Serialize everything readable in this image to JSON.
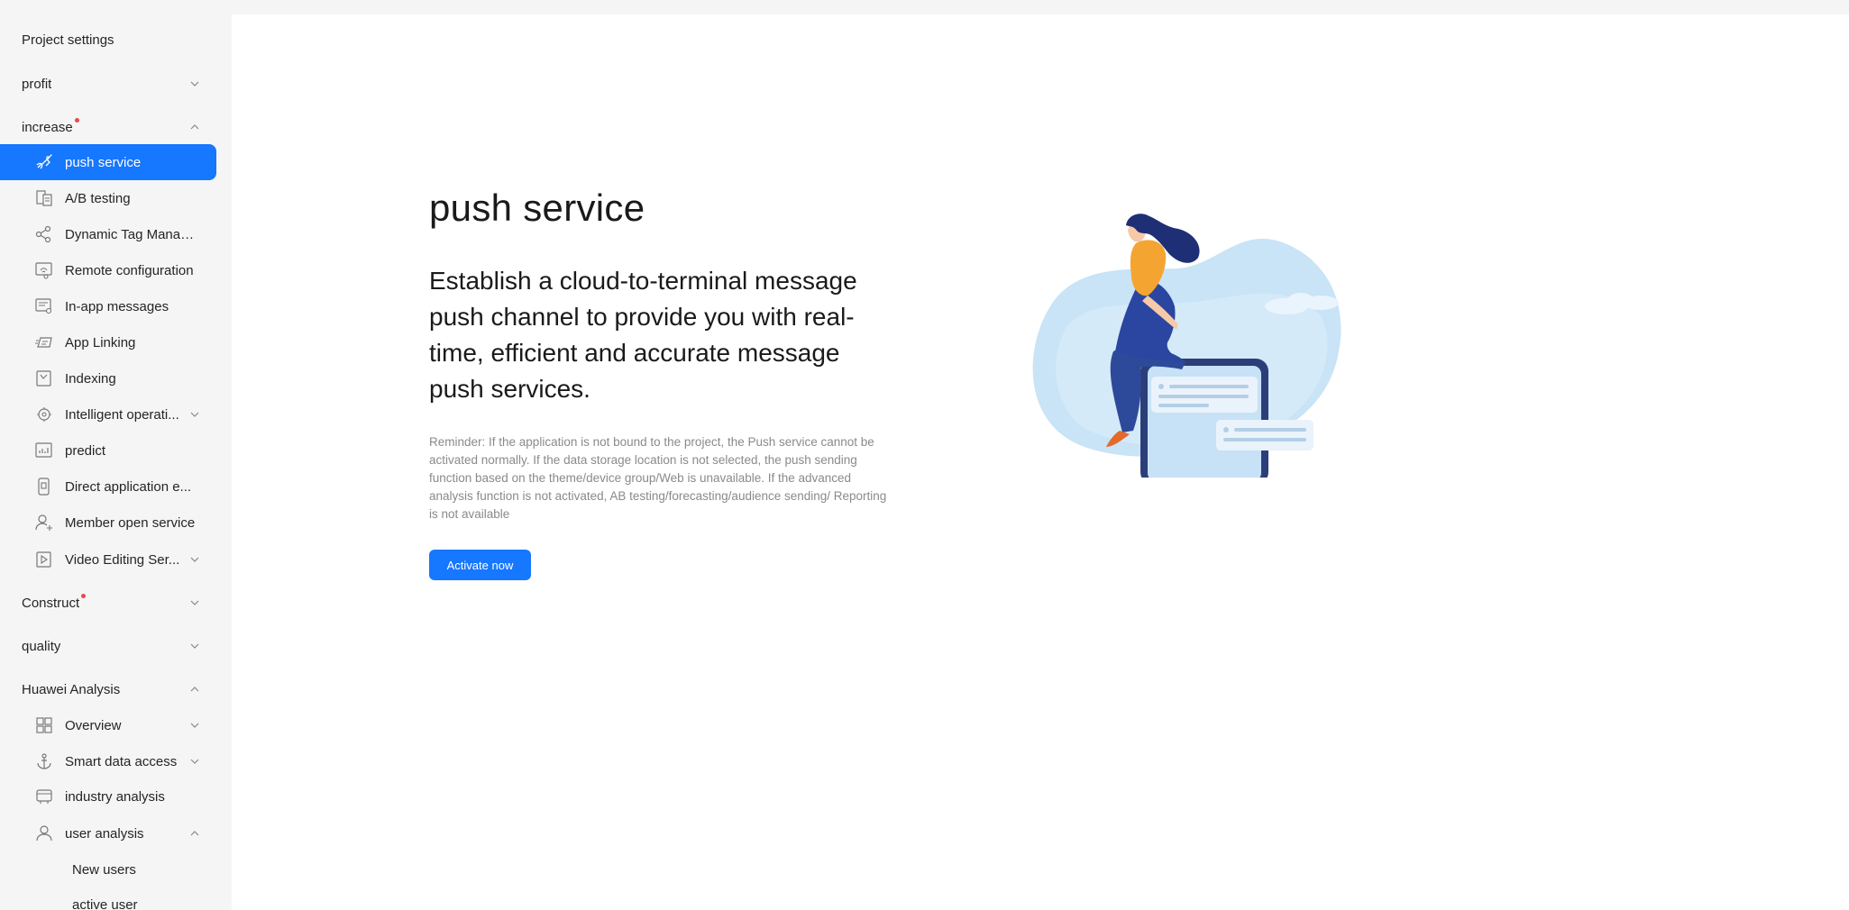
{
  "sidebar": {
    "project_settings": "Project settings",
    "profit": "profit",
    "increase": "increase",
    "items": [
      {
        "label": "push service",
        "icon": "rocket-icon"
      },
      {
        "label": "A/B testing",
        "icon": "ab-testing-icon"
      },
      {
        "label": "Dynamic Tag Manag...",
        "icon": "tag-network-icon"
      },
      {
        "label": "Remote configuration",
        "icon": "remote-config-icon"
      },
      {
        "label": "In-app messages",
        "icon": "in-app-message-icon"
      },
      {
        "label": "App Linking",
        "icon": "app-linking-icon"
      },
      {
        "label": "Indexing",
        "icon": "indexing-icon"
      },
      {
        "label": "Intelligent operati...",
        "icon": "intelligent-ops-icon"
      },
      {
        "label": "predict",
        "icon": "predict-icon"
      },
      {
        "label": "Direct application e...",
        "icon": "direct-app-icon"
      },
      {
        "label": "Member open service",
        "icon": "member-icon"
      },
      {
        "label": "Video Editing Ser...",
        "icon": "video-edit-icon"
      }
    ],
    "construct": "Construct",
    "quality": "quality",
    "huawei_analysis": "Huawei Analysis",
    "analysis_items": [
      {
        "label": "Overview",
        "icon": "grid-icon"
      },
      {
        "label": "Smart data access",
        "icon": "anchor-icon"
      },
      {
        "label": "industry analysis",
        "icon": "industry-icon"
      },
      {
        "label": "user analysis",
        "icon": "user-icon"
      }
    ],
    "user_analysis_children": [
      "New users",
      "active user"
    ]
  },
  "main": {
    "title": "push service",
    "description": "Establish a cloud-to-terminal message push channel to provide you with real-time, efficient and accurate message push services.",
    "reminder": "Reminder: If the application is not bound to the project, the Push service cannot be activated normally. If the data storage location is not selected, the push sending function based on the theme/device group/Web is unavailable. If the advanced analysis function is not activated, AB testing/forecasting/audience sending/ Reporting is not available",
    "activate_label": "Activate now"
  },
  "colors": {
    "accent": "#1677ff",
    "badge": "#e84a4a",
    "sidebar_bg": "#f5f5f5"
  }
}
